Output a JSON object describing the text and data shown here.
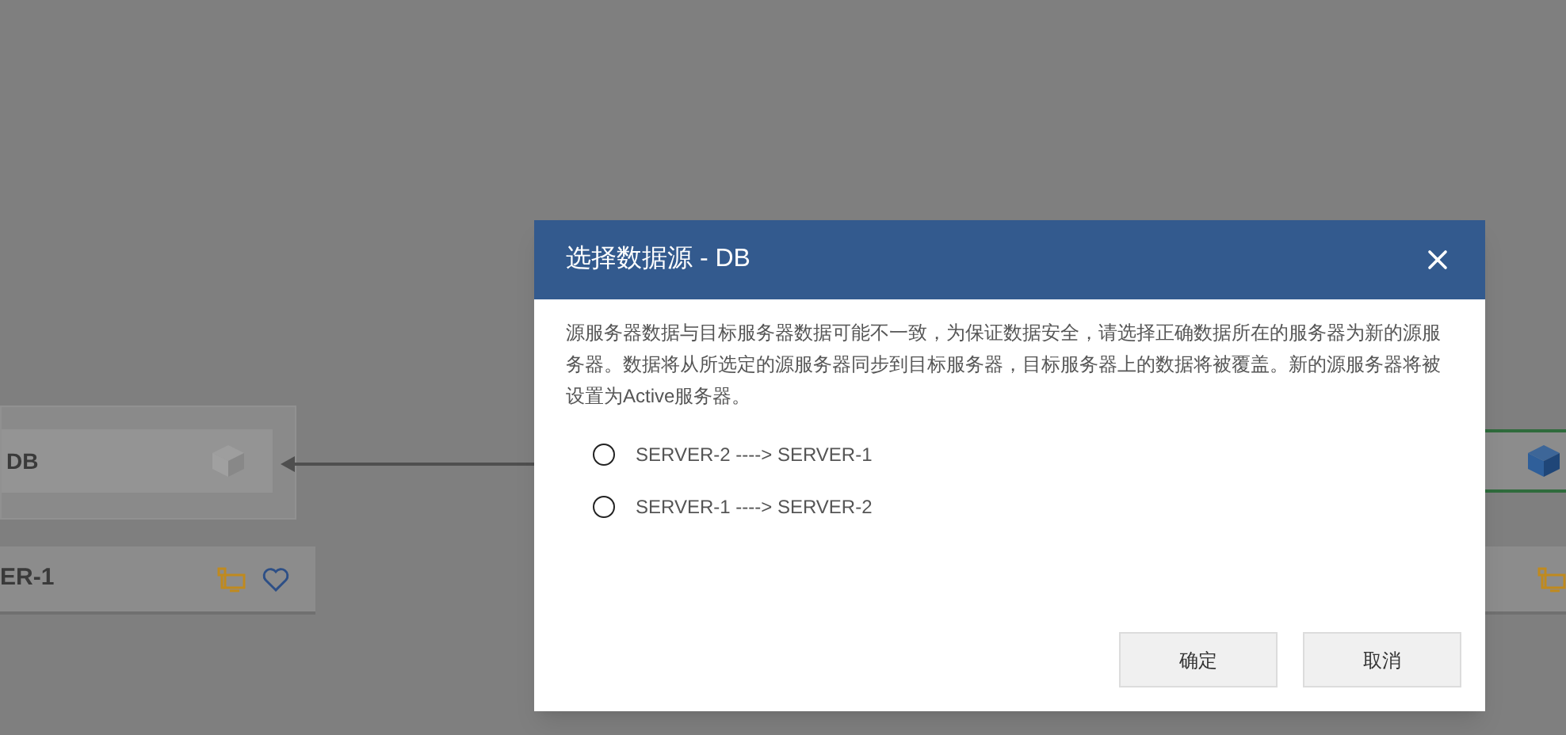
{
  "canvas": {
    "left_node": {
      "title": "DB",
      "server": "ER-1"
    }
  },
  "dialog": {
    "title": "选择数据源 - DB",
    "message": "源服务器数据与目标服务器数据可能不一致，为保证数据安全，请选择正确数据所在的服务器为新的源服务器。数据将从所选定的源服务器同步到目标服务器，目标服务器上的数据将被覆盖。新的源服务器将被设置为Active服务器。",
    "options": [
      {
        "label": "SERVER-2 ----> SERVER-1",
        "selected": false
      },
      {
        "label": "SERVER-1 ----> SERVER-2",
        "selected": false
      }
    ],
    "buttons": [
      "确定",
      "取消"
    ]
  }
}
